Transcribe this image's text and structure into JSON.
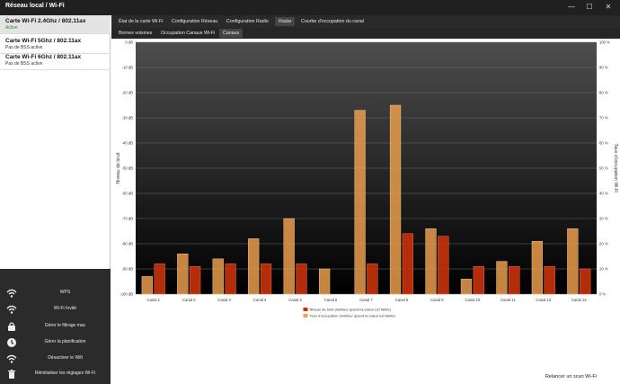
{
  "window": {
    "title": "Réseau local / Wi-Fi",
    "buttons": {
      "minimize": "—",
      "maximize": "☐",
      "close": "✕"
    }
  },
  "cards": [
    {
      "name": "Carte Wi-Fi 2.4Ghz / 802.11ax",
      "status": "Active",
      "selected": true
    },
    {
      "name": "Carte Wi-Fi 5Ghz / 802.11ax",
      "status": "Pas de BSS active",
      "selected": false
    },
    {
      "name": "Carte Wi-Fi 6Ghz / 802.11ax",
      "status": "Pas de BSS active",
      "selected": false
    }
  ],
  "menu": [
    {
      "label": "WPS",
      "icon": "wifi-icon"
    },
    {
      "label": "Wi-Fi Invité",
      "icon": "wifi-icon"
    },
    {
      "label": "Gérer le filtrage mac",
      "icon": "lock-icon"
    },
    {
      "label": "Gérer la planification",
      "icon": "clock-icon"
    },
    {
      "label": "Désactiver le Wifi",
      "icon": "wifi-icon"
    },
    {
      "label": "Réinitialiser les réglages Wi-Fi",
      "icon": "trash-icon"
    }
  ],
  "tabs": [
    {
      "label": "État de la carte Wi-Fi",
      "active": false
    },
    {
      "label": "Configuration Réseau",
      "active": false
    },
    {
      "label": "Configuration Radio",
      "active": false
    },
    {
      "label": "Radar",
      "active": true
    },
    {
      "label": "Courbe d'occupation du canal",
      "active": false
    }
  ],
  "subtabs": [
    {
      "label": "Bornes voisines",
      "active": false
    },
    {
      "label": "Occupation Canaux Wi-Fi",
      "active": false
    },
    {
      "label": "Canaux",
      "active": true
    }
  ],
  "rescan_label": "Relancer un scan Wi-Fi",
  "chart_data": {
    "type": "bar",
    "categories": [
      "Canal 1",
      "Canal 2",
      "Canal 3",
      "Canal 4",
      "Canal 5",
      "Canal 6",
      "Canal 7",
      "Canal 8",
      "Canal 9",
      "Canal 10",
      "Canal 11",
      "Canal 12",
      "Canal 13"
    ],
    "ylabel_left": "Niveau de bruit",
    "ylabel_right": "Taux d'occupation Wi-Fi",
    "yleft_range": [
      -100,
      0
    ],
    "yleft_ticks": [
      "0 dB",
      "-10 dB",
      "-20 dB",
      "-30 dB",
      "-40 dB",
      "-50 dB",
      "-60 dB",
      "-70 dB",
      "-80 dB",
      "-90 dB",
      "-100 dB"
    ],
    "yright_range": [
      0,
      100
    ],
    "yright_ticks": [
      "100 %",
      "90 %",
      "80 %",
      "70 %",
      "60 %",
      "50 %",
      "40 %",
      "30 %",
      "20 %",
      "10 %",
      "0 %"
    ],
    "grid": true,
    "legend_position": "bottom-center",
    "series": [
      {
        "name": "Taux d'occupation (meilleur quand la valeur est faible)",
        "axis": "right",
        "color": "#f0a14e",
        "values": [
          7,
          16,
          14,
          22,
          30,
          10,
          73,
          75,
          26,
          6,
          13,
          21,
          26
        ]
      },
      {
        "name": "Niveau de bruit (meilleur quand la valeur est faible)",
        "axis": "left",
        "color": "#c8320c",
        "values": [
          -88,
          -89,
          -88,
          -88,
          -88,
          -100,
          -88,
          -76,
          -77,
          -89,
          -89,
          -89,
          -90
        ]
      }
    ],
    "legend_order": [
      1,
      0
    ]
  }
}
